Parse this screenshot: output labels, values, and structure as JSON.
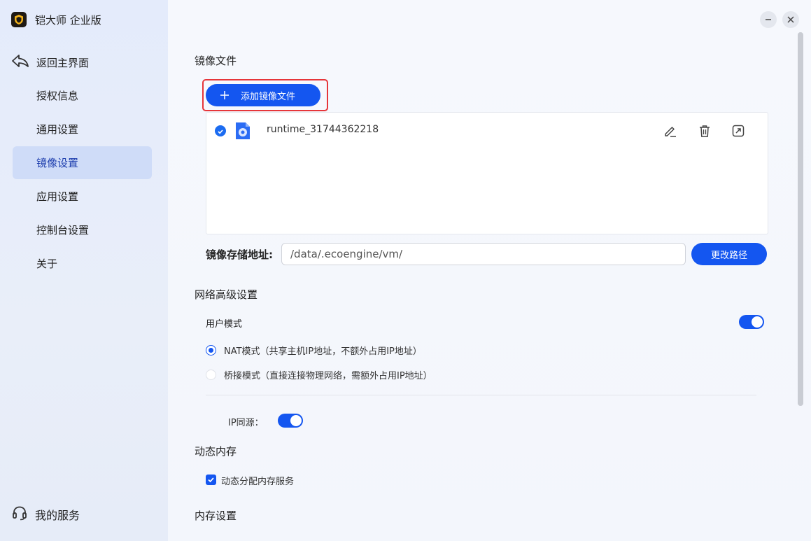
{
  "app": {
    "title": "铠大师 企业版"
  },
  "sidebar": {
    "back_label": "返回主界面",
    "items": [
      {
        "label": "授权信息",
        "active": false
      },
      {
        "label": "通用设置",
        "active": false
      },
      {
        "label": "镜像设置",
        "active": true
      },
      {
        "label": "应用设置",
        "active": false
      },
      {
        "label": "控制台设置",
        "active": false
      },
      {
        "label": "关于",
        "active": false
      }
    ],
    "service_label": "我的服务"
  },
  "main": {
    "image_section": {
      "title": "镜像文件",
      "add_button": "添加镜像文件",
      "files": [
        {
          "name": "runtime_31744362218",
          "selected": true
        }
      ],
      "storage_label": "镜像存储地址",
      "storage_colon": ":",
      "storage_path": "/data/.ecoengine/vm/",
      "change_button": "更改路径"
    },
    "network": {
      "title": "网络高级设置",
      "user_mode_label": "用户模式",
      "user_mode_enabled": true,
      "nat_label": "NAT模式（共享主机IP地址，不额外占用IP地址）",
      "nat_selected": true,
      "bridge_label": "桥接模式（直接连接物理网络，需额外占用IP地址）",
      "bridge_selected": false,
      "ip_same_label": "IP同源：",
      "ip_same_enabled": true
    },
    "memory": {
      "dynamic_title": "动态内存",
      "dynamic_service_label": "动态分配内存服务",
      "dynamic_service_checked": true,
      "settings_title": "内存设置"
    }
  },
  "colors": {
    "accent": "#1456f0",
    "highlight_border": "#e6363a",
    "sidebar_active": "#cfdcf8"
  },
  "icons": {
    "logo": "shield-logo-icon",
    "back": "back-arrow-icon",
    "service": "headset-icon",
    "file": "disc-file-icon",
    "edit": "edit-icon",
    "delete": "trash-icon",
    "export": "export-icon"
  }
}
